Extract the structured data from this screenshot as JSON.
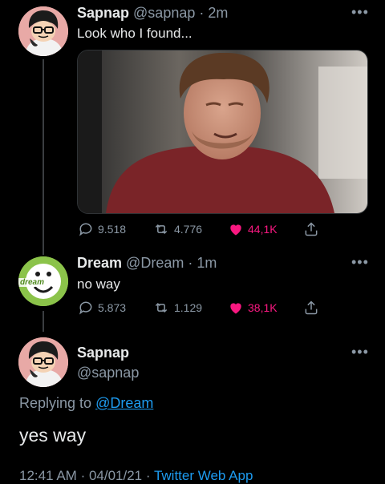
{
  "tweet1": {
    "name": "Sapnap",
    "handle": "@sapnap",
    "time": "2m",
    "text": "Look who I found...",
    "replies": "9.518",
    "retweets": "4.776",
    "likes": "44,1K"
  },
  "tweet2": {
    "name": "Dream",
    "handle": "@Dream",
    "time": "1m",
    "text": "no way",
    "avatar_label": "dream",
    "replies": "5.873",
    "retweets": "1.129",
    "likes": "38,1K"
  },
  "tweet3": {
    "name": "Sapnap",
    "handle": "@sapnap",
    "replying_prefix": "Replying to",
    "replying_handle": "@Dream",
    "text": "yes way",
    "meta_time": "12:41 AM",
    "meta_date": "04/01/21",
    "meta_app": "Twitter Web App"
  },
  "colors": {
    "background": "#000000",
    "link": "#1d9bf0",
    "like": "#f91880",
    "secondary_text": "#8b98a5",
    "dream_green": "#8bc34a"
  },
  "icons": [
    "reply-icon",
    "retweet-icon",
    "like-icon",
    "share-icon",
    "more-icon"
  ]
}
